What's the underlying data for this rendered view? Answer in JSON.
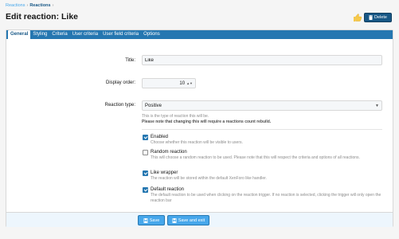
{
  "breadcrumb": {
    "items": [
      "Reactions",
      "Reactions"
    ],
    "separator": "›"
  },
  "page_title": "Edit reaction: Like",
  "header": {
    "delete_label": "Delete",
    "reaction_icon": "thumbs-up-icon"
  },
  "tabs": [
    {
      "label": "General",
      "active": true
    },
    {
      "label": "Styling",
      "active": false
    },
    {
      "label": "Criteria",
      "active": false
    },
    {
      "label": "User criteria",
      "active": false
    },
    {
      "label": "User field criteria",
      "active": false
    },
    {
      "label": "Options",
      "active": false
    }
  ],
  "form": {
    "title": {
      "label": "Title:",
      "value": "Like"
    },
    "display_order": {
      "label": "Display order:",
      "value": "10"
    },
    "reaction_type": {
      "label": "Reaction type:",
      "value": "Positive",
      "hint": "This is the type of reaction this will be.",
      "warning": "Please note that changing this will require a reactions count rebuild."
    },
    "options": [
      {
        "label": "Enabled",
        "checked": true,
        "hint": "Choose whether this reaction will be visible to users."
      },
      {
        "label": "Random reaction",
        "checked": false,
        "hint": "This will choose a random reaction to be used. Please note that this will respect the criteria and options of all reactions."
      },
      {
        "label": "Like wrapper",
        "checked": true,
        "hint": "The reaction will be stored within the default XenForo like handler."
      },
      {
        "label": "Default reaction",
        "checked": true,
        "hint": "The default reaction to be used when clicking on the reaction trigger. If no reaction is selected, clicking the trigger will only open the reaction bar"
      }
    ]
  },
  "footer": {
    "save_label": "Save",
    "save_exit_label": "Save and exit"
  },
  "colors": {
    "tab_bar": "#2577b1",
    "primary_button": "#47a7eb",
    "delete_button": "#185886"
  }
}
